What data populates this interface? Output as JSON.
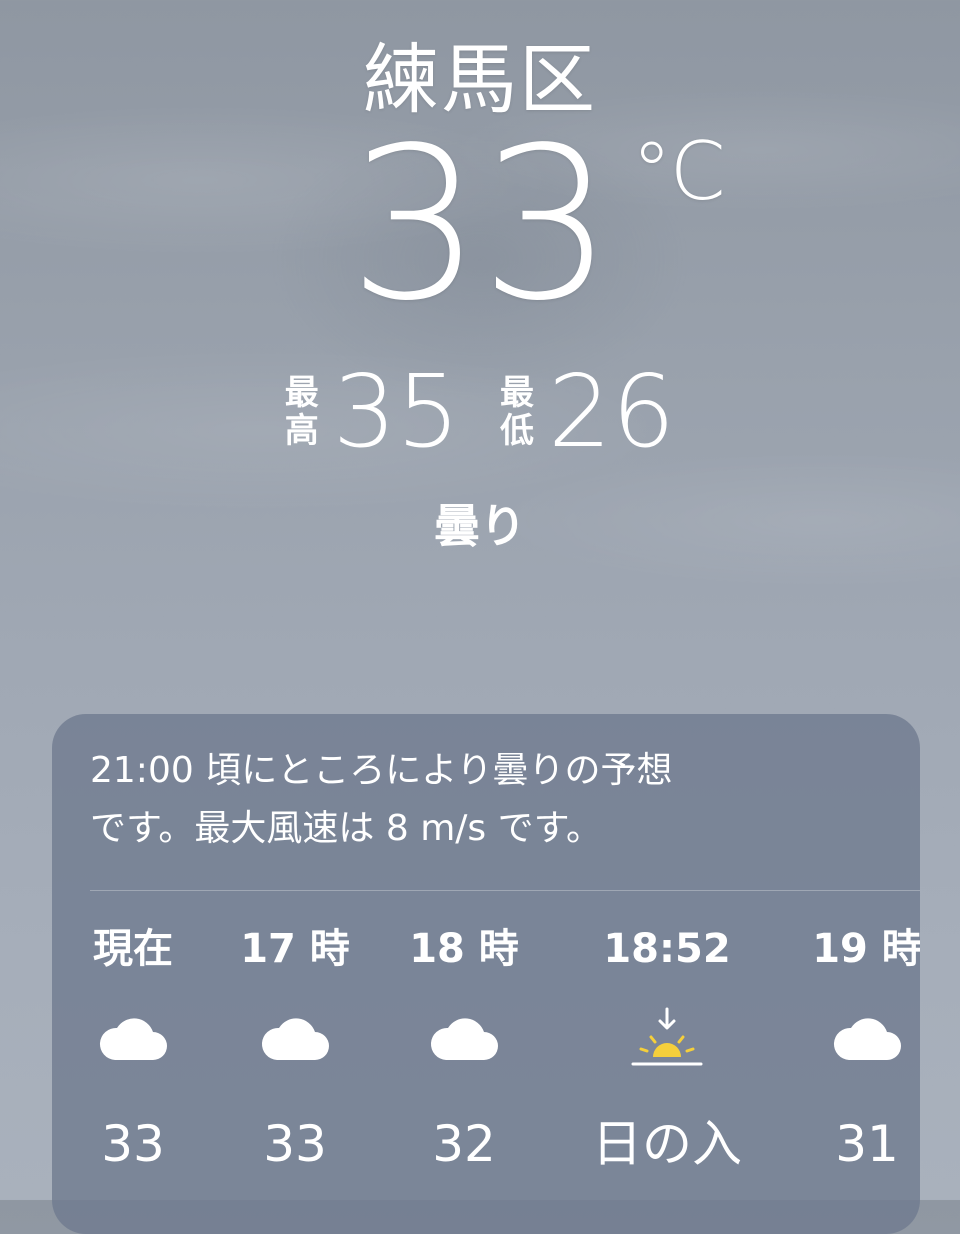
{
  "location": "練馬区",
  "current": {
    "temperature": "33",
    "unit": "°C",
    "high_label_1": "最",
    "high_label_2": "高",
    "high": "35",
    "low_label_1": "最",
    "low_label_2": "低",
    "low": "26",
    "condition": "曇り"
  },
  "forecast_card": {
    "summary_line1": "21:00 頃にところにより曇りの予想",
    "summary_line2": "です。最大風速は 8 m/s です。",
    "hourly": [
      {
        "label": "現在",
        "icon": "cloud-icon",
        "value": "33"
      },
      {
        "label": "17 時",
        "icon": "cloud-icon",
        "value": "33"
      },
      {
        "label": "18 時",
        "icon": "cloud-icon",
        "value": "32"
      },
      {
        "label": "18:52",
        "icon": "sunset-icon",
        "value": "日の入"
      },
      {
        "label": "19 時",
        "icon": "cloud-icon",
        "value": "31"
      }
    ]
  },
  "colors": {
    "sun": "#f5cf3b",
    "card": "#6e7a8e"
  }
}
